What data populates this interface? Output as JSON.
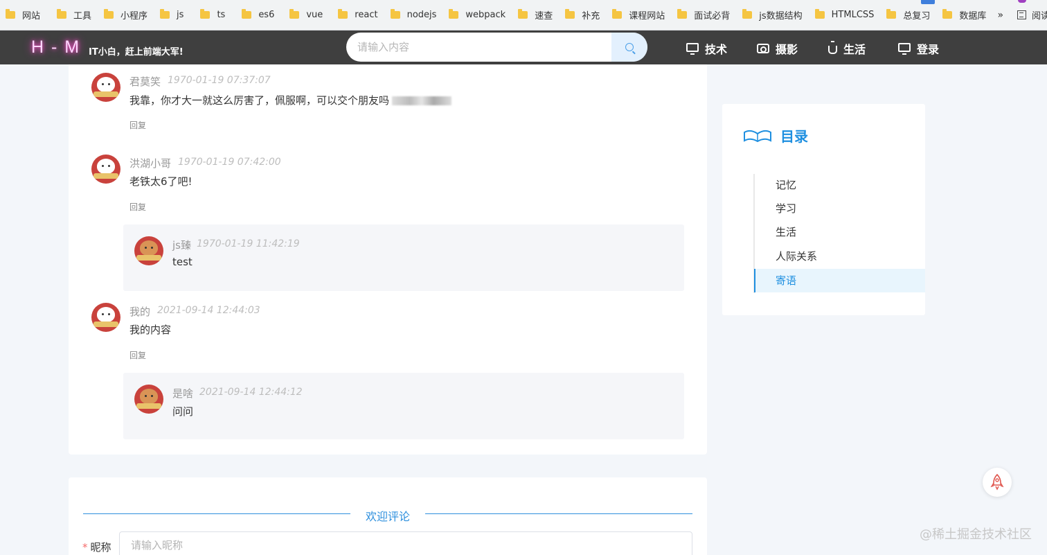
{
  "bookmarks": [
    {
      "label": "网站"
    },
    {
      "label": "工具"
    },
    {
      "label": "小程序"
    },
    {
      "label": "js"
    },
    {
      "label": "ts"
    },
    {
      "label": "es6"
    },
    {
      "label": "vue"
    },
    {
      "label": "react"
    },
    {
      "label": "nodejs"
    },
    {
      "label": "webpack"
    },
    {
      "label": "速查"
    },
    {
      "label": "补充"
    },
    {
      "label": "课程网站"
    },
    {
      "label": "面试必背"
    },
    {
      "label": "js数据结构"
    },
    {
      "label": "HTMLCSS"
    },
    {
      "label": "总复习"
    },
    {
      "label": "数据库"
    }
  ],
  "bookmarks_more": "»",
  "reading_list": "阅读清单",
  "header": {
    "logo": "H - M",
    "slogan": "IT小白，赶上前端大军!",
    "search_placeholder": "请输入内容",
    "nav": [
      {
        "label": "技术",
        "icon": "monitor-icon"
      },
      {
        "label": "摄影",
        "icon": "camera-icon"
      },
      {
        "label": "生活",
        "icon": "cup-icon"
      },
      {
        "label": "登录",
        "icon": "monitor-icon"
      }
    ]
  },
  "comments": [
    {
      "author": "君莫笑",
      "time": "1970-01-19 07:37:07",
      "content": "我靠，你才大一就这么厉害了，佩服啊，可以交个朋友吗",
      "reply": "回复"
    },
    {
      "author": "洪湖小哥",
      "time": "1970-01-19 07:42:00",
      "content": "老铁太6了吧!",
      "reply": "回复",
      "sub": {
        "author": "js臻",
        "time": "1970-01-19 11:42:19",
        "content": "test"
      }
    },
    {
      "author": "我的",
      "time": "2021-09-14 12:44:03",
      "content": "我的内容",
      "reply": "回复",
      "sub": {
        "author": "是啥",
        "time": "2021-09-14 12:44:12",
        "content": "问问"
      }
    }
  ],
  "toc": {
    "title": "目录",
    "items": [
      "记忆",
      "学习",
      "生活",
      "人际关系",
      "寄语"
    ],
    "active": "寄语"
  },
  "form": {
    "welcome": "欢迎评论",
    "nickname_label": "昵称",
    "nickname_placeholder": "请输入昵称"
  },
  "watermark": "@稀土掘金技术社区",
  "colors": {
    "accent": "#1e8fe0",
    "header_bg": "#3f3f3f",
    "logo_glow": "#ff5fd2"
  }
}
